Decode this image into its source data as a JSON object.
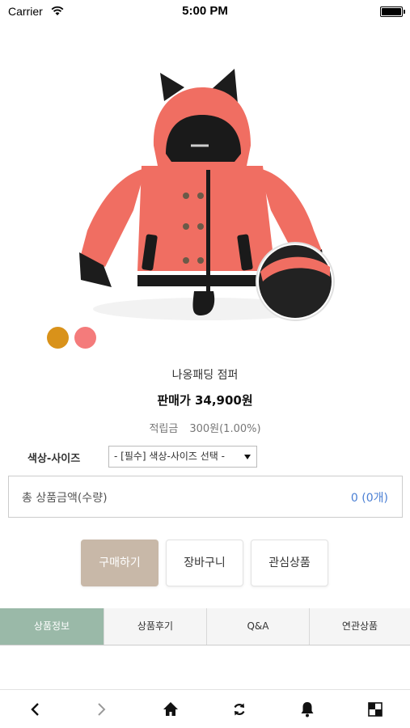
{
  "status_bar": {
    "carrier": "Carrier",
    "time": "5:00 PM"
  },
  "product": {
    "name": "나옹패딩 점퍼",
    "price": "판매가 34,900원",
    "points_label": "적립금",
    "points_value": "300원(1.00%)",
    "color_swatches": [
      "#d9921a",
      "#f47b7b"
    ]
  },
  "option": {
    "label": "색상-사이즈",
    "select_value": "- [필수] 색상-사이즈 선택 -"
  },
  "total": {
    "label": "총 상품금액(수량)",
    "value": "0 (0개)"
  },
  "buttons": {
    "buy": "구매하기",
    "cart": "장바구니",
    "wishlist": "관심상품"
  },
  "tabs": [
    "상품정보",
    "상품후기",
    "Q&A",
    "연관상품"
  ],
  "toolbar": {
    "icons": [
      "back-icon",
      "forward-icon",
      "home-icon",
      "refresh-icon",
      "bell-icon",
      "menu-grid-icon"
    ]
  },
  "colors": {
    "accent_tab": "#9ab9a8",
    "buy_button": "#c8b8a8",
    "total_value": "#4a7fd4"
  }
}
